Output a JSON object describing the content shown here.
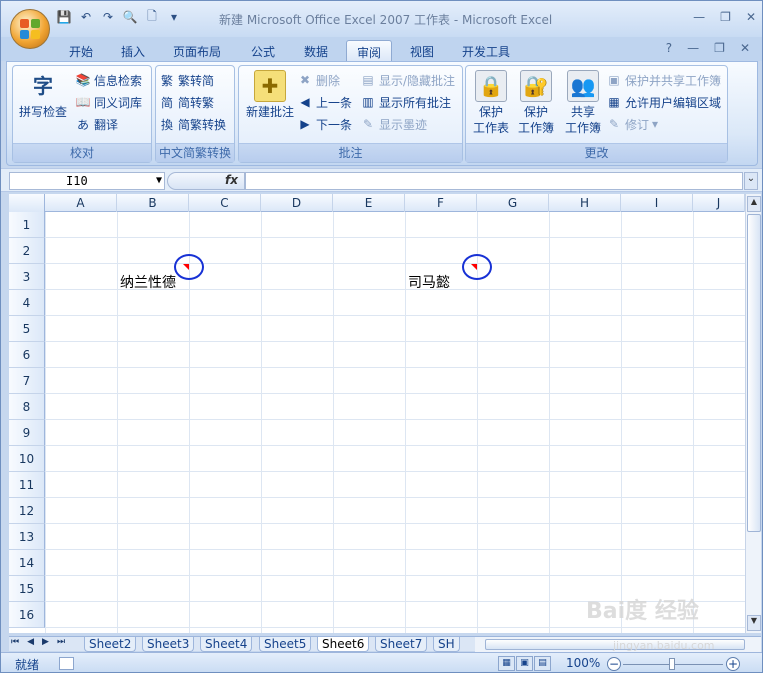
{
  "window": {
    "title": "新建 Microsoft Office Excel 2007 工作表 - Microsoft Excel",
    "controls": [
      "—",
      "❐",
      "✕"
    ]
  },
  "tabs": [
    "开始",
    "插入",
    "页面布局",
    "公式",
    "数据",
    "审阅",
    "视图",
    "开发工具"
  ],
  "ribbon_controls": [
    "?",
    "—",
    "❐",
    "✕"
  ],
  "ribbon": {
    "groups": [
      {
        "label": "校对",
        "big": "拼写检查",
        "smalls": [
          "信息检索",
          "同义词库",
          "翻译"
        ]
      },
      {
        "label": "中文简繁转换",
        "smalls": [
          "繁转简",
          "简转繁",
          "简繁转换"
        ]
      },
      {
        "label": "批注",
        "big": "新建批注",
        "smalls": [
          "删除",
          "上一条",
          "下一条",
          "显示/隐藏批注",
          "显示所有批注",
          "显示墨迹"
        ]
      },
      {
        "label": "更改",
        "big_buttons": [
          "保护\n工作表",
          "保护\n工作簿",
          "共享\n工作簿"
        ],
        "smalls": [
          "保护并共享工作簿",
          "允许用户编辑区域",
          "修订"
        ]
      }
    ]
  },
  "formula_bar": {
    "name_box": "I10",
    "fx_label": "fx",
    "content": ""
  },
  "columns": [
    "A",
    "B",
    "C",
    "D",
    "E",
    "F",
    "G",
    "H",
    "I",
    "J"
  ],
  "rows": [
    "1",
    "2",
    "3",
    "4",
    "5",
    "6",
    "7",
    "8",
    "9",
    "10",
    "11",
    "12",
    "13",
    "14",
    "15",
    "16"
  ],
  "cells": [
    {
      "ref": "B3",
      "text": "纳兰性德"
    },
    {
      "ref": "F3",
      "text": "司马懿"
    }
  ],
  "sheets": [
    "Sheet2",
    "Sheet3",
    "Sheet4",
    "Sheet5",
    "Sheet6",
    "Sheet7",
    "SH"
  ],
  "active_sheet": "Sheet6",
  "status": {
    "text": "就绪",
    "zoom": "100%"
  },
  "watermark": {
    "main": "Bai度 经验",
    "sub": "jingyan.baidu.com"
  }
}
